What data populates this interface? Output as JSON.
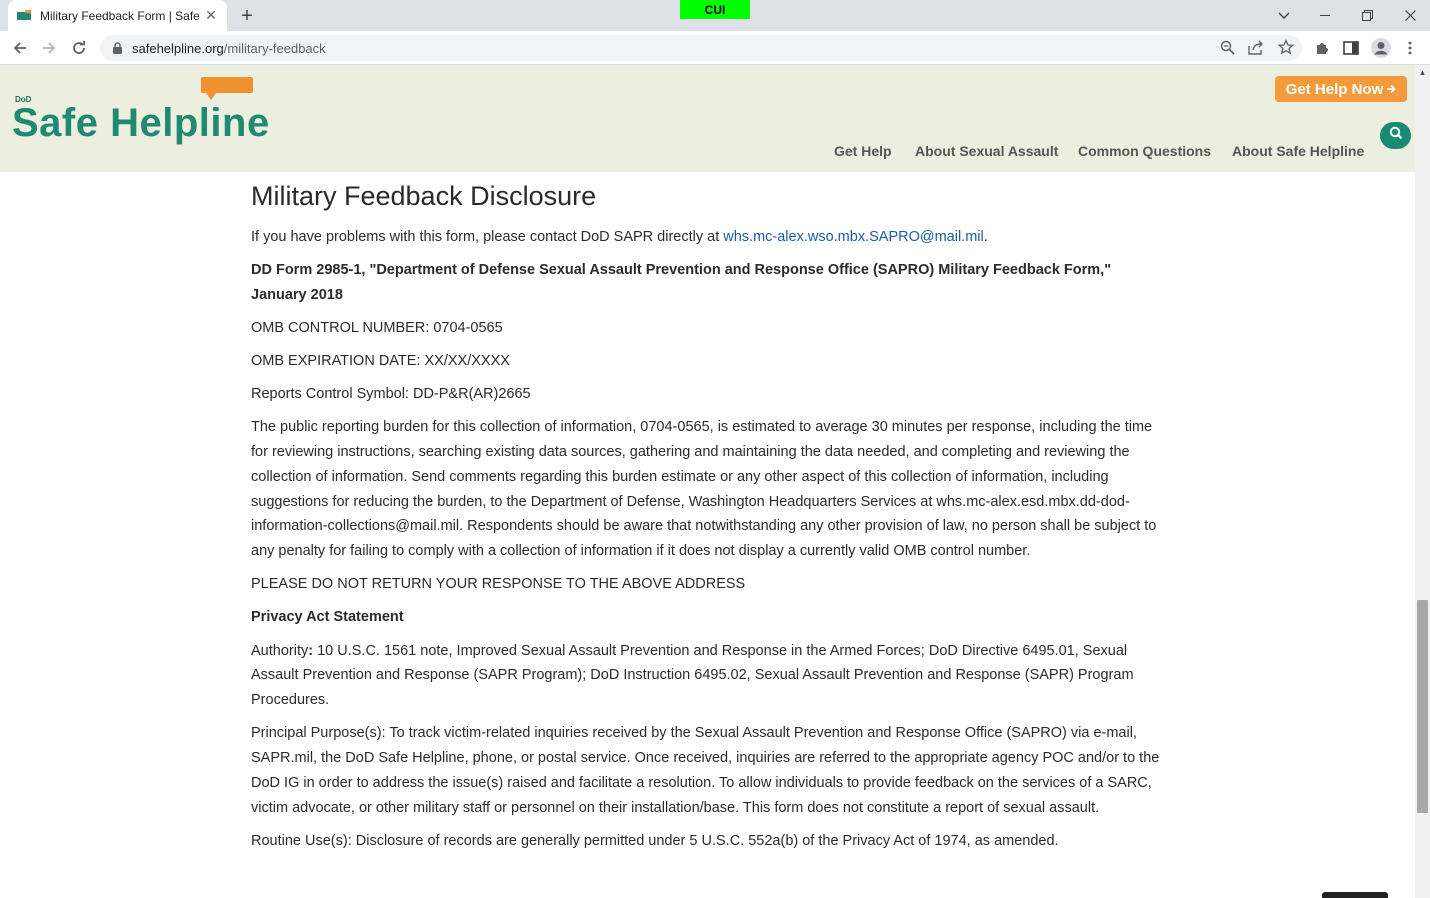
{
  "browser": {
    "tab_title": "Military Feedback Form | Safe Helpline",
    "cui_banner": "CUI",
    "url_domain": "safehelpline.org",
    "url_path": "/military-feedback"
  },
  "header": {
    "logo_dod": "DoD",
    "logo_text": "Safe Helpline",
    "help_now_label": "Get  Help Now",
    "nav": [
      "Get Help",
      "About Sexual Assault",
      "Common Questions",
      "About Safe Helpline"
    ]
  },
  "content": {
    "title": "Military Feedback Disclosure",
    "contact_prefix": "If you have problems with this form, please contact DoD SAPR directly at ",
    "contact_email": "whs.mc-alex.wso.mbx.SAPRO@mail.mil",
    "contact_suffix": ".",
    "form_title": "DD Form 2985-1, \"Department of Defense Sexual Assault Prevention and Response Office (SAPRO) Military Feedback Form,\" January 2018",
    "omb_control": "OMB CONTROL NUMBER: 0704-0565",
    "omb_expiration": "OMB EXPIRATION DATE: XX/XX/XXXX",
    "reports_symbol": "Reports Control Symbol: DD-P&R(AR)2665",
    "burden": "The public reporting burden for this collection of information, 0704-0565, is estimated to average 30 minutes per response, including the time for reviewing instructions, searching existing data sources, gathering and maintaining the data needed, and completing and reviewing the collection of information. Send comments regarding this burden estimate or any other aspect of this collection of information, including suggestions for reducing the burden, to the Department of Defense, Washington Headquarters Services at whs.mc-alex.esd.mbx.dd-dod-information-collections@mail.mil. Respondents should be aware that notwithstanding any other provision of law, no person shall be subject to any penalty for failing to comply with a collection of information if it does not display a currently valid OMB control number.",
    "do_not_return": "PLEASE DO NOT RETURN YOUR RESPONSE TO THE ABOVE ADDRESS",
    "privacy_heading": "Privacy Act Statement",
    "authority_label": "Authority",
    "authority_colon": ":",
    "authority_text": " 10 U.S.C. 1561 note, Improved Sexual Assault Prevention and Response in the Armed Forces;  DoD Directive 6495.01, Sexual Assault Prevention and Response (SAPR Program); DoD Instruction 6495.02, Sexual Assault Prevention and Response (SAPR) Program Procedures.",
    "principal_purpose": "Principal Purpose(s): To track victim-related inquiries received by the Sexual Assault Prevention and Response Office (SAPRO) via e-mail, SAPR.mil, the DoD Safe Helpline, phone, or postal service.  Once received, inquiries are referred to the appropriate agency POC and/or to the DoD IG in order to address the issue(s) raised and facilitate a resolution.  To allow individuals to provide feedback on the services of a SARC, victim advocate, or other military staff or personnel on their installation/base. This form does not constitute a report of sexual assault.",
    "routine_use": "Routine Use(s): Disclosure of records are generally permitted under 5 U.S.C. 552a(b) of the Privacy Act of 1974, as amended."
  },
  "colors": {
    "header_bg": "#eceedf",
    "brand_green": "#1f8a70",
    "accent_orange": "#f39a3b",
    "link_blue": "#1e5aa8",
    "cui_green": "#00ff00"
  }
}
